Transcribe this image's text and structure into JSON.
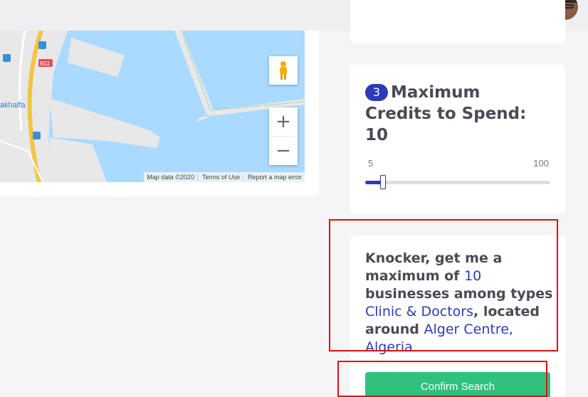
{
  "header": {
    "avatar_icon": "user-avatar"
  },
  "map": {
    "labels": {
      "road": "N11",
      "place": "akhalfa"
    },
    "attribution": {
      "data": "Map data ©2020",
      "terms": "Terms of Use",
      "report": "Report a map error"
    },
    "zoom_in": "+",
    "zoom_out": "−",
    "pegman_icon": "pegman-icon"
  },
  "credits": {
    "step_number": "3",
    "heading": "Maximum Credits to Spend: 10",
    "min_label": "5",
    "max_label": "100",
    "min_value": 5,
    "max_value": 100,
    "value": 10
  },
  "summary": {
    "part1": "Knocker, get me a maximum of ",
    "count": "10",
    "part2": " businesses among types ",
    "types": "Clinic & Doctors",
    "part3": ", located around ",
    "location": "Alger Centre, Algeria"
  },
  "actions": {
    "confirm_label": "Confirm Search"
  },
  "colors": {
    "accent": "#2d3bb8",
    "confirm": "#2ec27e",
    "highlight_box": "#e01010",
    "water": "#aadaff"
  }
}
